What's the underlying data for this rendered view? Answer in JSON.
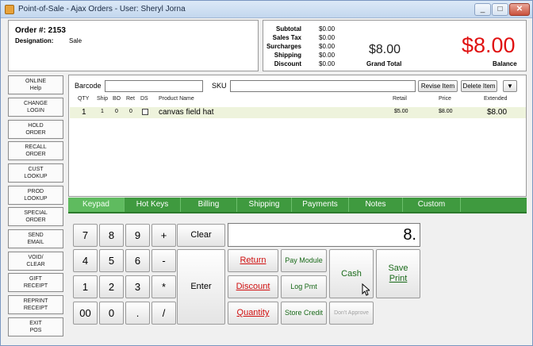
{
  "window": {
    "title": "Point-of-Sale - Ajax Orders - User: Sheryl Jorna",
    "minimize": "_",
    "restore": "□",
    "close": "✕"
  },
  "order": {
    "number": "Order #: 2153",
    "designation_label": "Designation:",
    "designation_value": "Sale"
  },
  "totals": {
    "rows": [
      {
        "label": "Subtotal",
        "value": "$0.00"
      },
      {
        "label": "Sales Tax",
        "value": "$0.00"
      },
      {
        "label": "Surcharges",
        "value": "$0.00"
      },
      {
        "label": "Shipping",
        "value": "$0.00"
      },
      {
        "label": "Discount",
        "value": "$0.00"
      }
    ],
    "grand_total_amount": "$8.00",
    "grand_total_label": "Grand Total",
    "balance_amount": "$8.00",
    "balance_label": "Balance"
  },
  "sidebar": [
    {
      "line1": "ONLINE",
      "line2": "Help"
    },
    {
      "line1": "CHANGE",
      "line2": "LOGIN"
    },
    {
      "line1": "HOLD",
      "line2": "ORDER"
    },
    {
      "line1": "RECALL",
      "line2": "ORDER"
    },
    {
      "line1": "CUST",
      "line2": "LOOKUP"
    },
    {
      "line1": "PROD",
      "line2": "LOOKUP"
    },
    {
      "line1": "SPECIAL",
      "line2": "ORDER"
    },
    {
      "line1": "SEND",
      "line2": "EMAIL"
    },
    {
      "line1": "VOID/",
      "line2": "CLEAR"
    },
    {
      "line1": "GIFT",
      "line2": "RECEIPT"
    },
    {
      "line1": "REPRINT",
      "line2": "RECEIPT"
    },
    {
      "line1": "EXIT",
      "line2": "POS"
    }
  ],
  "entry": {
    "barcode_label": "Barcode",
    "sku_label": "SKU",
    "barcode_value": "",
    "sku_value": "",
    "revise_item": "Revise Item",
    "delete_item": "Delete Item"
  },
  "table": {
    "headers": {
      "qty": "QTY",
      "ship": "Ship",
      "bo": "BO",
      "ret": "Ret",
      "ds": "DS",
      "product": "Product Name",
      "retail": "Retail",
      "price": "Price",
      "extended": "Extended"
    },
    "rows": [
      {
        "qty": "1",
        "ship": "1",
        "bo": "0",
        "ret": "0",
        "product": "canvas field hat",
        "retail": "$5.00",
        "price": "$8.00",
        "extended": "$8.00"
      }
    ]
  },
  "tabs": [
    "Keypad",
    "Hot Keys",
    "Billing",
    "Shipping",
    "Payments",
    "Notes",
    "Custom"
  ],
  "keypad": {
    "display": "8.",
    "keys": [
      "7",
      "8",
      "9",
      "+",
      "4",
      "5",
      "6",
      "-",
      "1",
      "2",
      "3",
      "*",
      "00",
      "0",
      ".",
      "/"
    ],
    "clear": "Clear",
    "enter": "Enter"
  },
  "actions": {
    "return": "Return",
    "discount": "Discount",
    "quantity": "Quantity",
    "pay_module": "Pay Module",
    "log_pmt": "Log Pmt",
    "store_credit": "Store Credit",
    "cash": "Cash",
    "dont_approve": "Don't Approve",
    "save_print_1": "Save",
    "save_print_2": "Print"
  },
  "colors": {
    "tab_green": "#3f9a3f",
    "balance_red": "#e01010",
    "action_red": "#d01010",
    "action_green": "#1a6a1a"
  }
}
